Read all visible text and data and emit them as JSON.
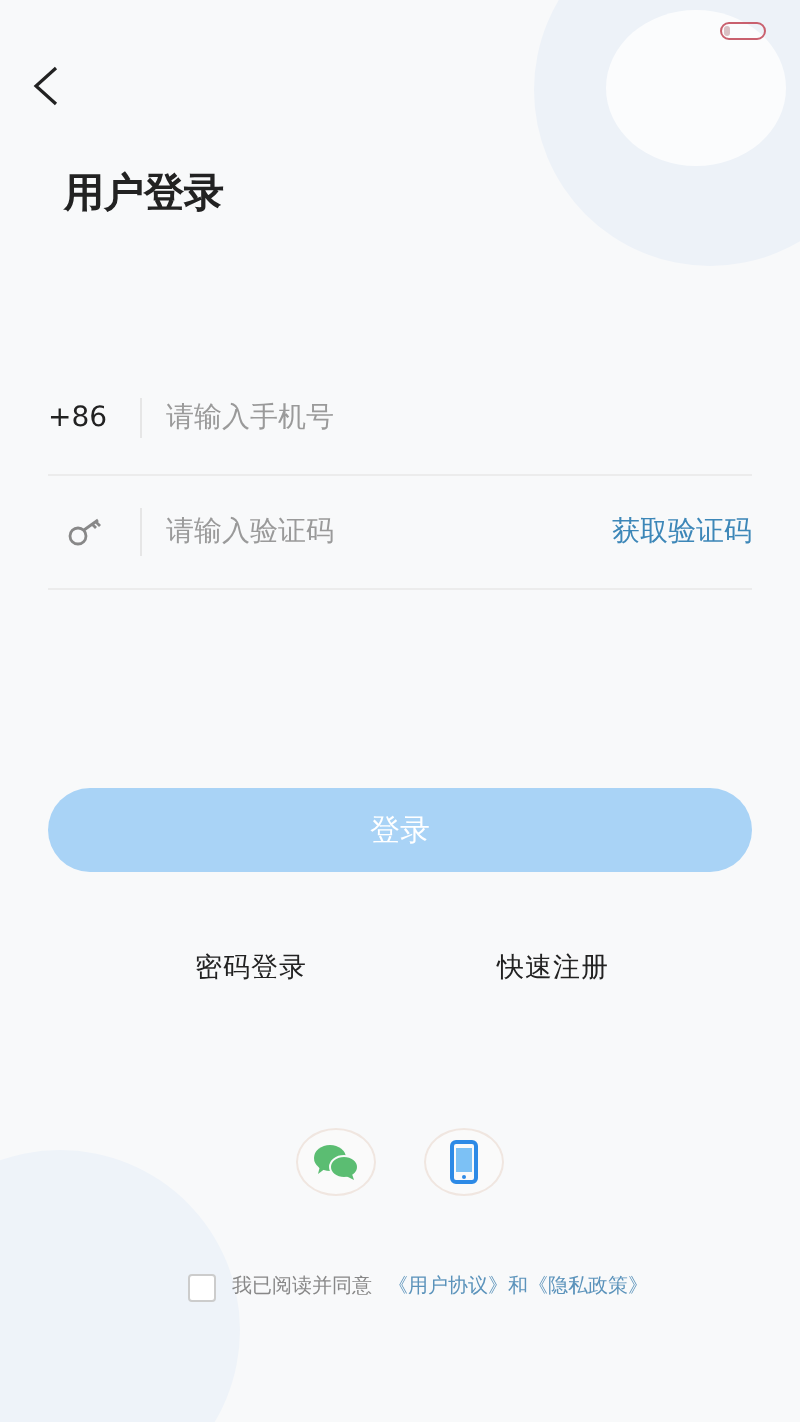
{
  "title": "用户登录",
  "phone": {
    "prefix": "+86",
    "placeholder": "请输入手机号"
  },
  "code": {
    "placeholder": "请输入验证码",
    "action": "获取验证码"
  },
  "login_button": {
    "label": "登录",
    "disabled": true
  },
  "links": [
    "密码登录",
    "快速注册"
  ],
  "social": [
    {
      "kind": "wechat"
    },
    {
      "kind": "phone"
    }
  ],
  "agreement": {
    "checked": false,
    "text": "我已阅读并同意",
    "links": [
      "《用户协议》",
      "和",
      "《隐私政策》"
    ]
  }
}
